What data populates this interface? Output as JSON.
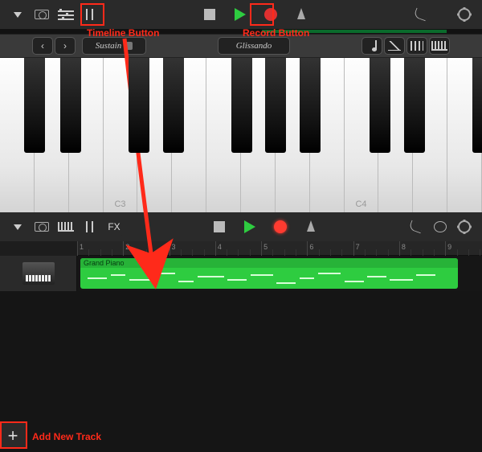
{
  "annotations": {
    "timeline_label": "Timeline Button",
    "record_label": "Record Button",
    "add_track_label": "Add New Track"
  },
  "top_view": {
    "subbar": {
      "prev": "‹",
      "next": "›",
      "sustain_label": "Sustain",
      "glissando_label": "Glissando"
    },
    "key_labels": {
      "c3": "C3",
      "c4": "C4"
    }
  },
  "bottom_view": {
    "fx_label": "FX",
    "ruler_numbers": [
      "1",
      "2",
      "3",
      "4",
      "5",
      "6",
      "7",
      "8",
      "9"
    ],
    "region": {
      "title": "Grand Piano"
    },
    "add_track_glyph": "+"
  }
}
